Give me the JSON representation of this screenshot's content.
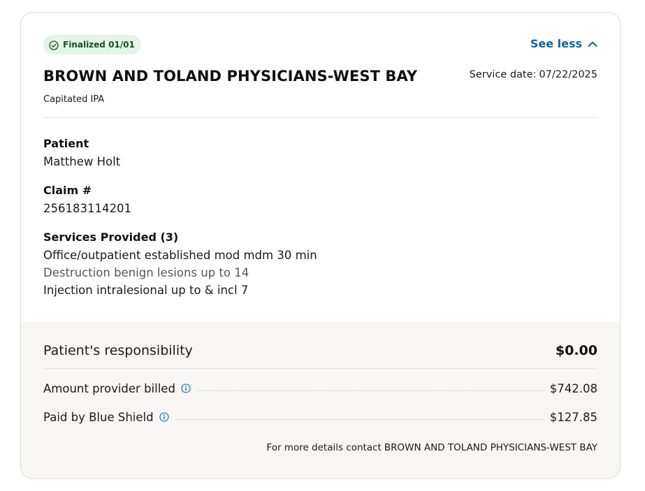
{
  "status": {
    "label": "Finalized 01/01",
    "color": "#e3f5e6",
    "icon": "check-circle-icon"
  },
  "toggle": {
    "label": "See less",
    "icon": "chevron-up-icon",
    "color": "#0a66a5"
  },
  "provider": {
    "name": "BROWN AND TOLAND PHYSICIANS-WEST BAY",
    "type": "Capitated IPA"
  },
  "service_date": {
    "label": "Service date:",
    "value": "07/22/2025"
  },
  "patient": {
    "label": "Patient",
    "value": "Matthew Holt"
  },
  "claim": {
    "label": "Claim #",
    "value": "256183114201"
  },
  "services": {
    "label": "Services Provided (3)",
    "items": [
      "Office/outpatient established mod mdm 30 min",
      "Destruction benign lesions up to 14",
      "Injection intralesional up to & incl 7"
    ]
  },
  "summary": {
    "responsibility_label": "Patient's responsibility",
    "responsibility_value": "$0.00",
    "billed_label": "Amount provider billed",
    "billed_value": "$742.08",
    "paid_label": "Paid by Blue Shield",
    "paid_value": "$127.85",
    "info_icon": "info-icon"
  },
  "footnote": {
    "text": "For more details contact",
    "provider": "BROWN AND TOLAND PHYSICIANS-WEST BAY"
  }
}
